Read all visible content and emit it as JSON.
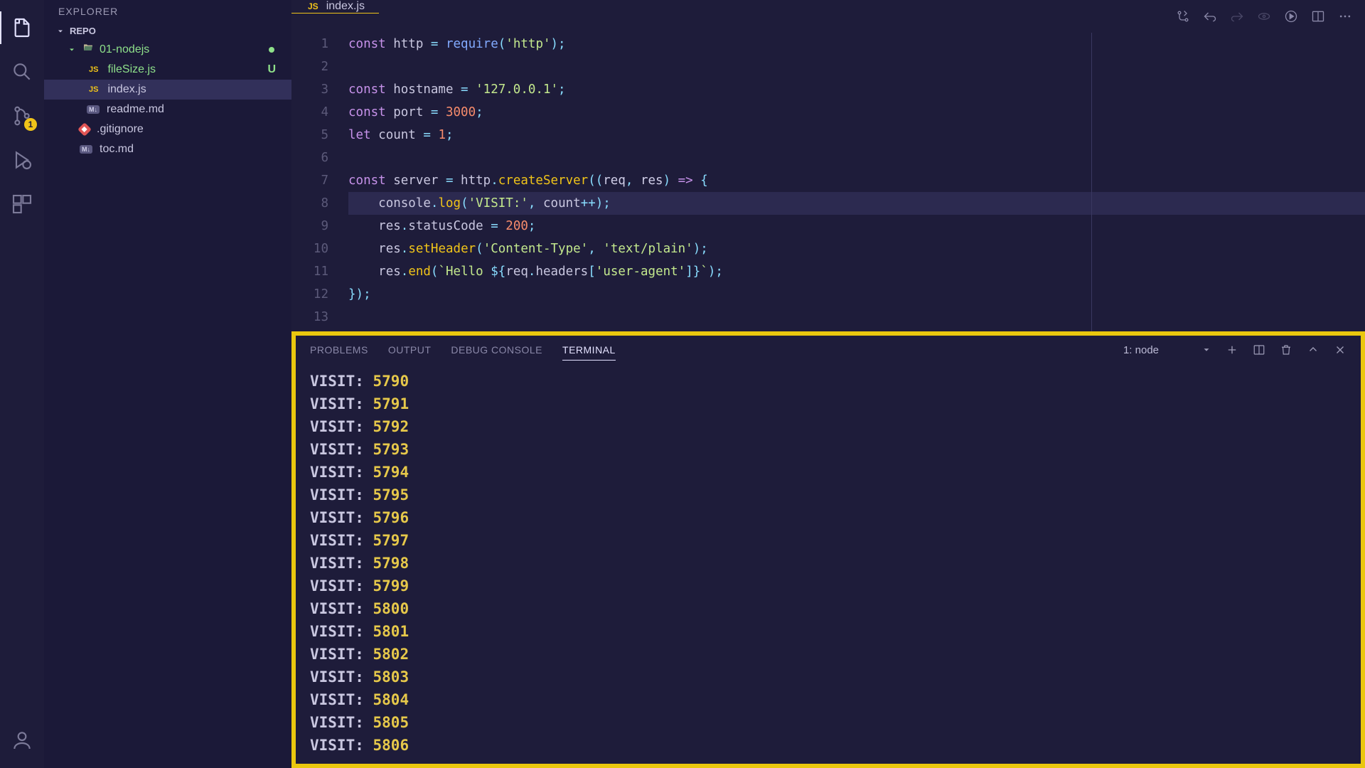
{
  "activityBar": {
    "scmBadge": "1"
  },
  "sidebar": {
    "title": "EXPLORER",
    "section": "REPO",
    "folder": "01-nodejs",
    "files": [
      {
        "name": "fileSize.js",
        "badge": "js",
        "modified": true,
        "status": "U",
        "selected": false,
        "root": false
      },
      {
        "name": "index.js",
        "badge": "js",
        "modified": false,
        "status": "",
        "selected": true,
        "root": false
      },
      {
        "name": "readme.md",
        "badge": "md",
        "modified": false,
        "status": "",
        "selected": false,
        "root": false
      },
      {
        "name": ".gitignore",
        "badge": "gitignore",
        "modified": false,
        "status": "",
        "selected": false,
        "root": true
      },
      {
        "name": "toc.md",
        "badge": "md",
        "modified": false,
        "status": "",
        "selected": false,
        "root": true
      }
    ]
  },
  "tabs": {
    "open": [
      {
        "label": "index.js",
        "badge": "JS",
        "active": true
      }
    ]
  },
  "editor": {
    "lines": [
      [
        {
          "t": "const ",
          "c": "kw"
        },
        {
          "t": "http",
          "c": "var"
        },
        {
          "t": " = ",
          "c": "op"
        },
        {
          "t": "require",
          "c": "fn"
        },
        {
          "t": "(",
          "c": "op"
        },
        {
          "t": "'http'",
          "c": "str"
        },
        {
          "t": ");",
          "c": "op"
        }
      ],
      [],
      [
        {
          "t": "const ",
          "c": "kw"
        },
        {
          "t": "hostname",
          "c": "var"
        },
        {
          "t": " = ",
          "c": "op"
        },
        {
          "t": "'127.0.0.1'",
          "c": "str"
        },
        {
          "t": ";",
          "c": "op"
        }
      ],
      [
        {
          "t": "const ",
          "c": "kw"
        },
        {
          "t": "port",
          "c": "var"
        },
        {
          "t": " = ",
          "c": "op"
        },
        {
          "t": "3000",
          "c": "num"
        },
        {
          "t": ";",
          "c": "op"
        }
      ],
      [
        {
          "t": "let ",
          "c": "kw"
        },
        {
          "t": "count",
          "c": "var"
        },
        {
          "t": " = ",
          "c": "op"
        },
        {
          "t": "1",
          "c": "num"
        },
        {
          "t": ";",
          "c": "op"
        }
      ],
      [],
      [
        {
          "t": "const ",
          "c": "kw"
        },
        {
          "t": "server",
          "c": "var"
        },
        {
          "t": " = ",
          "c": "op"
        },
        {
          "t": "http",
          "c": "var"
        },
        {
          "t": ".",
          "c": "op"
        },
        {
          "t": "createServer",
          "c": "call"
        },
        {
          "t": "((",
          "c": "op"
        },
        {
          "t": "req",
          "c": "param"
        },
        {
          "t": ", ",
          "c": "op"
        },
        {
          "t": "res",
          "c": "param"
        },
        {
          "t": ") ",
          "c": "op"
        },
        {
          "t": "=>",
          "c": "kw"
        },
        {
          "t": " {",
          "c": "op"
        }
      ],
      [
        {
          "t": "    ",
          "c": ""
        },
        {
          "t": "console",
          "c": "var"
        },
        {
          "t": ".",
          "c": "op"
        },
        {
          "t": "log",
          "c": "call"
        },
        {
          "t": "(",
          "c": "op"
        },
        {
          "t": "'VISIT:'",
          "c": "str"
        },
        {
          "t": ", ",
          "c": "op"
        },
        {
          "t": "count",
          "c": "var"
        },
        {
          "t": "++",
          "c": "op"
        },
        {
          "t": ");",
          "c": "op"
        }
      ],
      [
        {
          "t": "    ",
          "c": ""
        },
        {
          "t": "res",
          "c": "var"
        },
        {
          "t": ".",
          "c": "op"
        },
        {
          "t": "statusCode",
          "c": "var"
        },
        {
          "t": " = ",
          "c": "op"
        },
        {
          "t": "200",
          "c": "num"
        },
        {
          "t": ";",
          "c": "op"
        }
      ],
      [
        {
          "t": "    ",
          "c": ""
        },
        {
          "t": "res",
          "c": "var"
        },
        {
          "t": ".",
          "c": "op"
        },
        {
          "t": "setHeader",
          "c": "call"
        },
        {
          "t": "(",
          "c": "op"
        },
        {
          "t": "'Content-Type'",
          "c": "str"
        },
        {
          "t": ", ",
          "c": "op"
        },
        {
          "t": "'text/plain'",
          "c": "str"
        },
        {
          "t": ");",
          "c": "op"
        }
      ],
      [
        {
          "t": "    ",
          "c": ""
        },
        {
          "t": "res",
          "c": "var"
        },
        {
          "t": ".",
          "c": "op"
        },
        {
          "t": "end",
          "c": "call"
        },
        {
          "t": "(",
          "c": "op"
        },
        {
          "t": "`",
          "c": "str"
        },
        {
          "t": "Hello ",
          "c": "str"
        },
        {
          "t": "${",
          "c": "tmpl"
        },
        {
          "t": "req",
          "c": "var"
        },
        {
          "t": ".",
          "c": "op"
        },
        {
          "t": "headers",
          "c": "var"
        },
        {
          "t": "[",
          "c": "op"
        },
        {
          "t": "'user-agent'",
          "c": "str"
        },
        {
          "t": "]",
          "c": "op"
        },
        {
          "t": "}",
          "c": "tmpl"
        },
        {
          "t": "`",
          "c": "str"
        },
        {
          "t": ");",
          "c": "op"
        }
      ],
      [
        {
          "t": "});",
          "c": "op"
        }
      ],
      []
    ],
    "highlightLine": 8
  },
  "panel": {
    "tabs": [
      "PROBLEMS",
      "OUTPUT",
      "DEBUG CONSOLE",
      "TERMINAL"
    ],
    "activeTab": "TERMINAL",
    "select": "1: node"
  },
  "terminal": {
    "prefix": "VISIT:",
    "startCount": 5790,
    "endCount": 5806
  }
}
